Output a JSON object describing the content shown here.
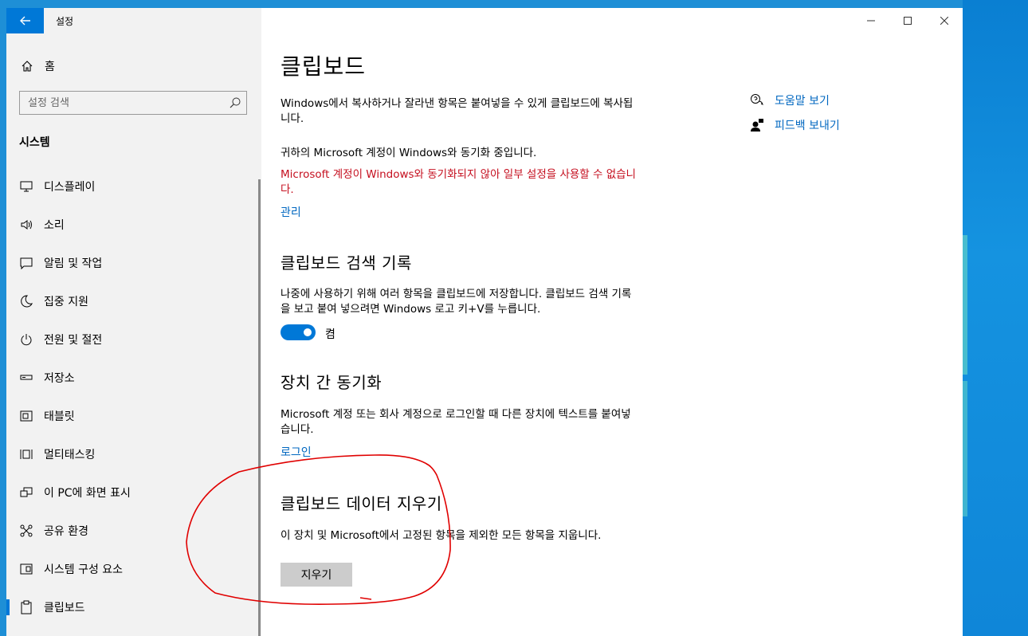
{
  "window": {
    "app_title": "설정",
    "minimize": "—",
    "maximize": "☐",
    "close": "✕"
  },
  "sidebar": {
    "home_label": "홈",
    "search_placeholder": "설정 검색",
    "section_title": "시스템",
    "items": [
      {
        "label": "디스플레이",
        "icon": "display-icon"
      },
      {
        "label": "소리",
        "icon": "speaker-icon"
      },
      {
        "label": "알림 및 작업",
        "icon": "notification-icon"
      },
      {
        "label": "집중 지원",
        "icon": "moon-icon"
      },
      {
        "label": "전원 및 절전",
        "icon": "power-icon"
      },
      {
        "label": "저장소",
        "icon": "storage-icon"
      },
      {
        "label": "태블릿",
        "icon": "tablet-icon"
      },
      {
        "label": "멀티태스킹",
        "icon": "multitasking-icon"
      },
      {
        "label": "이 PC에 화면 표시",
        "icon": "project-icon"
      },
      {
        "label": "공유 환경",
        "icon": "share-icon"
      },
      {
        "label": "시스템 구성 요소",
        "icon": "components-icon"
      },
      {
        "label": "클립보드",
        "icon": "clipboard-icon",
        "active": true
      }
    ]
  },
  "main": {
    "title": "클립보드",
    "intro": "Windows에서 복사하거나 잘라낸 항목은 붙여넣을 수 있게 클립보드에 복사됩니다.",
    "account_sync": "귀하의 Microsoft 계정이 Windows와 동기화 중입니다.",
    "account_error": "Microsoft 계정이 Windows와 동기화되지 않아 일부 설정을 사용할 수 없습니다.",
    "manage_link": "관리",
    "history": {
      "heading": "클립보드 검색 기록",
      "desc": "나중에 사용하기 위해 여러 항목을 클립보드에 저장합니다. 클립보드 검색 기록을 보고 붙여 넣으려면 Windows 로고 키+V를 누릅니다.",
      "toggle_state": "켬"
    },
    "sync": {
      "heading": "장치 간 동기화",
      "desc": "Microsoft 계정 또는 회사 계정으로 로그인할 때 다른 장치에 텍스트를 붙여넣습니다.",
      "signin_link": "로그인"
    },
    "clear": {
      "heading": "클립보드 데이터 지우기",
      "desc": "이 장치 및 Microsoft에서 고정된 항목을 제외한 모든 항목을 지웁니다.",
      "button": "지우기"
    },
    "related": [
      {
        "label": "도움말 보기",
        "icon": "help-icon"
      },
      {
        "label": "피드백 보내기",
        "icon": "feedback-icon"
      }
    ]
  },
  "colors": {
    "accent": "#0078d7",
    "link": "#0067c0",
    "error": "#c50f1f",
    "annotation": "#e00000"
  }
}
